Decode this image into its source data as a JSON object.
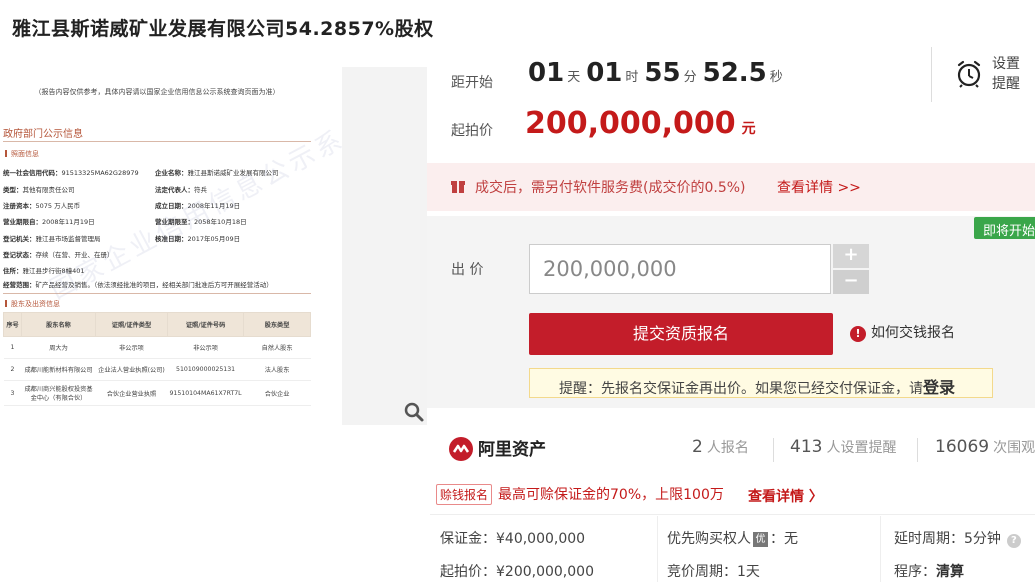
{
  "title": "雅江县斯诺威矿业发展有限公司54.2857%股权",
  "doc": {
    "note": "（报告内容仅供参考，具体内容请以国家企业信用信息公示系统查询页面为准）",
    "section": "政府部门公示信息",
    "sub1": "照面信息",
    "fields": [
      {
        "k": "统一社会信用代码：",
        "v": "91513325MA62G28979"
      },
      {
        "k": "企业名称：",
        "v": "雅江县斯诺威矿业发展有限公司"
      },
      {
        "k": "类型：",
        "v": "其他有限责任公司"
      },
      {
        "k": "法定代表人：",
        "v": "符兵"
      },
      {
        "k": "注册资本：",
        "v": "5075 万人民币"
      },
      {
        "k": "成立日期：",
        "v": "2008年11月19日"
      },
      {
        "k": "营业期限自：",
        "v": "2008年11月19日"
      },
      {
        "k": "营业期限至：",
        "v": "2058年10月18日"
      },
      {
        "k": "登记机关：",
        "v": "雅江县市场监督管理局"
      },
      {
        "k": "核准日期：",
        "v": "2017年05月09日"
      },
      {
        "k": "登记状态：",
        "v": "存续（在营、开业、在册）"
      },
      {
        "k": "住所：",
        "v": "雅江县步行街8幢401"
      },
      {
        "k": "经营范围：",
        "v": "矿产品经营及销售。（依法须经批准的项目，经相关部门批准后方可开展经营活动）"
      }
    ],
    "sub2": "股东及出资信息",
    "table_headers": [
      "序号",
      "股东名称",
      "证照/证件类型",
      "证照/证件号码",
      "股东类型"
    ],
    "table_rows": [
      [
        "1",
        "周大为",
        "非公示项",
        "非公示项",
        "自然人股东"
      ],
      [
        "2",
        "成都川能新材料有限公司",
        "企业法人营业执照(公司)",
        "510109000025131",
        "法人股东"
      ],
      [
        "3",
        "成都川商兴能股权投资基金中心（有限合伙）",
        "合伙企业营业执照",
        "91510104MA61X7RT7L",
        "合伙企业"
      ]
    ],
    "watermark": "国家企业信用信息公示系统"
  },
  "countdown": {
    "label": "距开始",
    "days": "01",
    "days_unit": "天",
    "hours": "01",
    "hours_unit": "时",
    "minutes": "55",
    "minutes_unit": "分",
    "seconds": "52.5",
    "seconds_unit": "秒"
  },
  "remind": {
    "line1": "设置",
    "line2": "提醒"
  },
  "start_price": {
    "label": "起拍价",
    "value": "200,000,000",
    "unit": "元"
  },
  "notice": {
    "text": "成交后，需另付软件服务费(成交价的0.5%)",
    "link": "查看详情 >>"
  },
  "bid": {
    "badge": "即将开始",
    "label": "出 价",
    "value": "200,000,000",
    "plus": "+",
    "minus": "−",
    "submit": "提交资质报名",
    "help": "如何交钱报名",
    "tip_prefix": "提醒：先报名交保证金再出价。如果您已经交付保证金，请",
    "tip_login": "登录"
  },
  "stats": {
    "brand": "阿里资产",
    "signup_count": "2",
    "signup_label": "人报名",
    "remind_count": "413",
    "remind_label": "人设置提醒",
    "view_count": "16069",
    "view_label": "次围观"
  },
  "promo": {
    "tag": "赊钱报名",
    "text": "最高可赊保证金的70%，上限100万",
    "link": "查看详情 〉"
  },
  "info": {
    "deposit": "保证金：¥40,000,000",
    "priority_label": "优先购买权人",
    "priority_badge": "优",
    "priority_value": "：无",
    "delay": "延时周期：5分钟",
    "start_price": "起拍价：¥200,000,000",
    "bid_period": "竞价周期：1天",
    "procedure_label": "程序：",
    "procedure_value": "清算"
  },
  "colors": {
    "accent": "#c31d2a",
    "green": "#3aa64a",
    "notice_bg": "#fbeeee"
  }
}
